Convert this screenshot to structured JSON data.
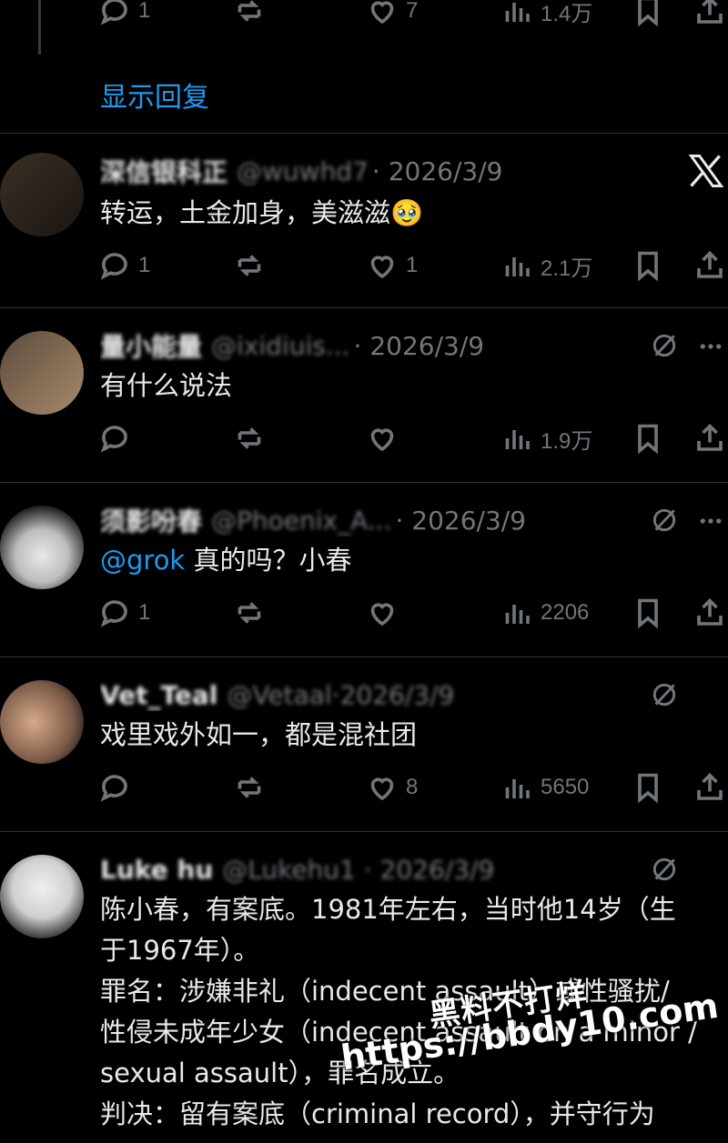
{
  "top_bar": {
    "reply_count": "1",
    "like_count": "7",
    "views": "1.4万"
  },
  "show_replies": "显示回复",
  "tweets": [
    {
      "name": "深信银科正",
      "handle": "@wuwhd7",
      "date": "· 2026/3/9",
      "text": "转运，土金加身，美滋滋",
      "emoji": "🥹",
      "reply_count": "1",
      "like_count": "1",
      "views": "2.1万"
    },
    {
      "name": "量小能量",
      "handle": "@ixidiuis...",
      "date": "· 2026/3/9",
      "text": "有什么说法",
      "reply_count": "",
      "like_count": "",
      "views": "1.9万"
    },
    {
      "name": "须影吩春",
      "handle": "@Phoenix_A...",
      "date": "· 2026/3/9",
      "mention": "@grok",
      "text": " 真的吗？小春",
      "reply_count": "1",
      "like_count": "",
      "views": "2206"
    },
    {
      "name": "Vet_Teal",
      "handle": "@Vetaal·2026/3/9",
      "date": "",
      "text": "戏里戏外如一，都是混社团",
      "reply_count": "",
      "like_count": "8",
      "views": "5650"
    },
    {
      "name": "Luke hu",
      "handle": "@Lukehu1 · 2026/3/9",
      "date": "",
      "text_lines": [
        "陈小春，有案底。1981年左右，当时他14岁（生",
        "于1967年）。",
        "罪名：涉嫌非礼（indecent assault）或性骚扰/",
        "性侵未成年少女（indecent assault on a minor /",
        "sexual assault），罪名成立。",
        "判决：留有案底（criminal record），并守行为"
      ]
    }
  ],
  "watermark": {
    "line1": "黑料不打烊",
    "line2": "https://bbdy10.com"
  },
  "colors": {
    "background": "#000000",
    "text": "#e7e9ea",
    "muted": "#71767b",
    "link": "#1d9bf0",
    "separator": "#2f3336"
  }
}
